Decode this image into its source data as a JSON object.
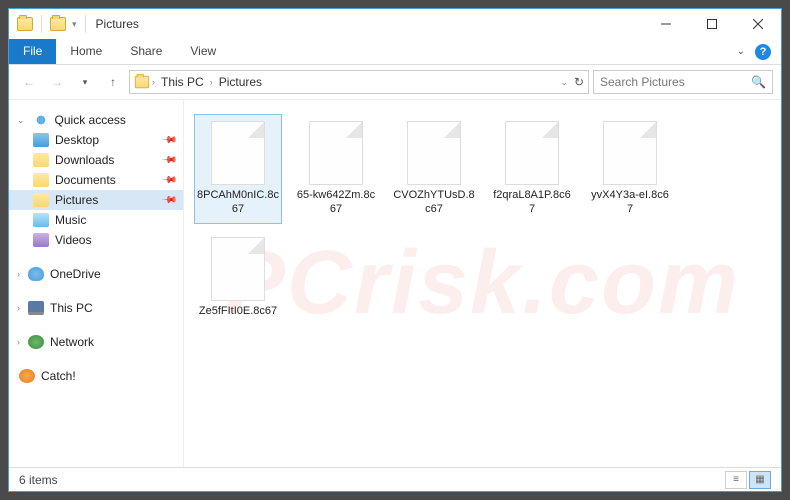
{
  "window": {
    "title": "Pictures"
  },
  "ribbon": {
    "tabs": {
      "file": "File",
      "home": "Home",
      "share": "Share",
      "view": "View"
    }
  },
  "breadcrumb": {
    "root": "This PC",
    "current": "Pictures"
  },
  "search": {
    "placeholder": "Search Pictures"
  },
  "nav": {
    "quick_access": "Quick access",
    "items": [
      {
        "label": "Desktop"
      },
      {
        "label": "Downloads"
      },
      {
        "label": "Documents"
      },
      {
        "label": "Pictures"
      },
      {
        "label": "Music"
      },
      {
        "label": "Videos"
      }
    ],
    "onedrive": "OneDrive",
    "this_pc": "This PC",
    "network": "Network",
    "catch": "Catch!"
  },
  "files": [
    {
      "name": "8PCAhM0nIC.8c67"
    },
    {
      "name": "65-kw642Zm.8c67"
    },
    {
      "name": "CVOZhYTUsD.8c67"
    },
    {
      "name": "f2qraL8A1P.8c67"
    },
    {
      "name": "yvX4Y3a-eI.8c67"
    },
    {
      "name": "Ze5fFItI0E.8c67"
    }
  ],
  "status": {
    "count": "6 items"
  },
  "watermark": "PCrisk.com"
}
